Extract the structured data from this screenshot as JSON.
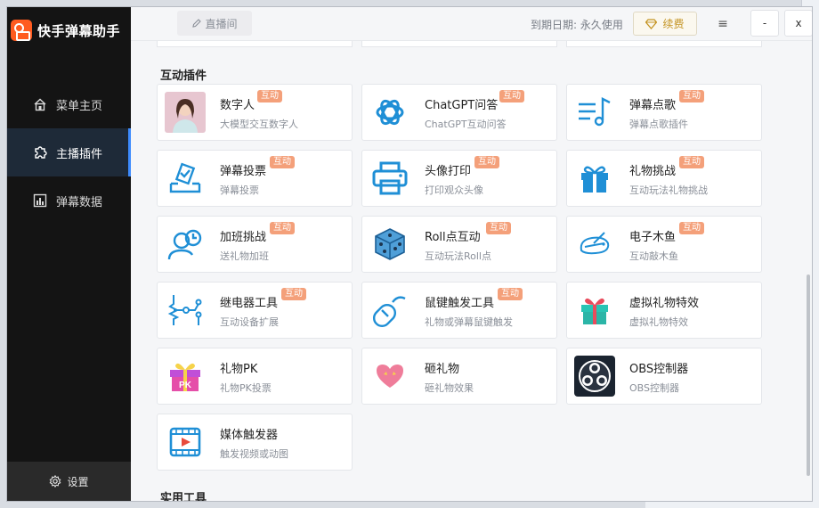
{
  "app": {
    "title": "快手弹幕助手"
  },
  "sidebar": {
    "items": [
      {
        "label": "菜单主页",
        "icon": "home-icon",
        "active": false
      },
      {
        "label": "主播插件",
        "icon": "plugin-icon",
        "active": true
      },
      {
        "label": "弹幕数据",
        "icon": "bar-chart-icon",
        "active": false
      }
    ],
    "settings_label": "设置"
  },
  "topbar": {
    "live_tab": "直播间",
    "expire_text": "到期日期: 永久使用",
    "renew_label": "续费",
    "menu_glyph": "≡",
    "minimize_glyph": "-",
    "close_glyph": "x"
  },
  "sections": {
    "interactive": "互动插件",
    "tools": "实用工具"
  },
  "badge_text": "互动",
  "cards": [
    {
      "id": "digital-human",
      "title": "数字人",
      "desc": "大模型交互数字人",
      "badge": true
    },
    {
      "id": "chatgpt",
      "title": "ChatGPT问答",
      "desc": "ChatGPT互动问答",
      "badge": true
    },
    {
      "id": "song-request",
      "title": "弹幕点歌",
      "desc": "弹幕点歌插件",
      "badge": true
    },
    {
      "id": "danmu-vote",
      "title": "弹幕投票",
      "desc": "弹幕投票",
      "badge": true
    },
    {
      "id": "avatar-print",
      "title": "头像打印",
      "desc": "打印观众头像",
      "badge": true
    },
    {
      "id": "gift-challenge",
      "title": "礼物挑战",
      "desc": "互动玩法礼物挑战",
      "badge": true
    },
    {
      "id": "overtime-challenge",
      "title": "加班挑战",
      "desc": "送礼物加班",
      "badge": true
    },
    {
      "id": "roll-dice",
      "title": "Roll点互动",
      "desc": "互动玩法Roll点",
      "badge": true
    },
    {
      "id": "wooden-fish",
      "title": "电子木鱼",
      "desc": "互动敲木鱼",
      "badge": true
    },
    {
      "id": "relay-tool",
      "title": "继电器工具",
      "desc": "互动设备扩展",
      "badge": true
    },
    {
      "id": "mouse-key-trigger",
      "title": "鼠键触发工具",
      "desc": "礼物或弹幕鼠键触发",
      "badge": true
    },
    {
      "id": "virtual-gift",
      "title": "虚拟礼物特效",
      "desc": "虚拟礼物特效",
      "badge": false
    },
    {
      "id": "gift-pk",
      "title": "礼物PK",
      "desc": "礼物PK投票",
      "badge": false
    },
    {
      "id": "smash-gift",
      "title": "砸礼物",
      "desc": "砸礼物效果",
      "badge": false
    },
    {
      "id": "obs-controller",
      "title": "OBS控制器",
      "desc": "OBS控制器",
      "badge": false
    },
    {
      "id": "media-trigger",
      "title": "媒体触发器",
      "desc": "触发视频或动图",
      "badge": false
    }
  ],
  "colors": {
    "sidebar_bg": "#141414",
    "active_nav_bg": "#1e2a38",
    "accent": "#3d8bfd",
    "badge": "#f4a07a",
    "renew": "#c49423",
    "icon_blue": "#1f8fd6"
  }
}
